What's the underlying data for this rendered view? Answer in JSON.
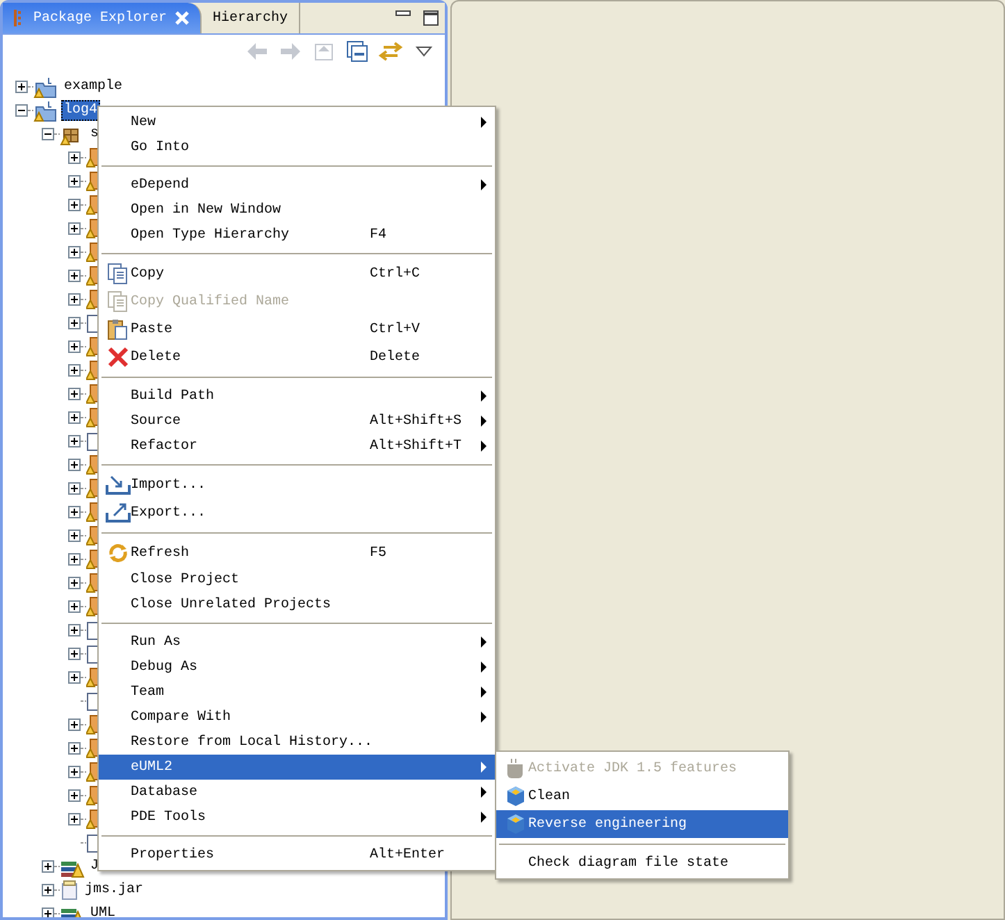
{
  "view_tabs": [
    {
      "label": "Package Explorer",
      "selected": true
    },
    {
      "label": "Hierarchy",
      "selected": false
    }
  ],
  "toolbar": [
    {
      "kind": "back",
      "disabled": true
    },
    {
      "kind": "forward",
      "disabled": true
    },
    {
      "kind": "up",
      "disabled": true
    },
    {
      "kind": "collapse",
      "disabled": false
    },
    {
      "kind": "link",
      "disabled": false
    },
    {
      "kind": "view-menu",
      "disabled": false
    }
  ],
  "tree": [
    {
      "label": "example",
      "kind": "project",
      "expanded": false,
      "selected": false
    },
    {
      "label": "log4",
      "kind": "project",
      "expanded": true,
      "selected": true,
      "children": [
        {
          "label": "s",
          "kind": "source",
          "expanded": true,
          "selected": false,
          "children": [
            {
              "kind": "package",
              "expanded": false
            },
            {
              "kind": "package",
              "expanded": false
            },
            {
              "kind": "package",
              "expanded": false
            },
            {
              "kind": "package",
              "expanded": false
            },
            {
              "kind": "package",
              "expanded": false
            },
            {
              "kind": "package",
              "expanded": false
            },
            {
              "kind": "package",
              "expanded": false
            },
            {
              "kind": "file",
              "expanded": false
            },
            {
              "kind": "package",
              "expanded": false
            },
            {
              "kind": "package",
              "expanded": false
            },
            {
              "kind": "package",
              "expanded": false
            },
            {
              "kind": "package",
              "expanded": false
            },
            {
              "kind": "file",
              "expanded": false
            },
            {
              "kind": "package",
              "expanded": false
            },
            {
              "kind": "package",
              "expanded": false
            },
            {
              "kind": "package",
              "expanded": false
            },
            {
              "kind": "package",
              "expanded": false
            },
            {
              "kind": "package",
              "expanded": false
            },
            {
              "kind": "package",
              "expanded": false
            },
            {
              "kind": "package",
              "expanded": false
            },
            {
              "kind": "file",
              "expanded": false
            },
            {
              "kind": "file",
              "expanded": false
            },
            {
              "kind": "package",
              "expanded": false
            },
            {
              "kind": "file"
            },
            {
              "kind": "package",
              "expanded": false
            },
            {
              "kind": "package",
              "expanded": false
            },
            {
              "kind": "package",
              "expanded": false
            },
            {
              "kind": "package",
              "expanded": false
            },
            {
              "kind": "package",
              "expanded": false
            },
            {
              "kind": "file"
            }
          ]
        },
        {
          "label": "J",
          "kind": "library",
          "expanded": false,
          "selected": false
        },
        {
          "label": "jms.jar",
          "kind": "jar",
          "expanded": false,
          "selected": false
        },
        {
          "label": "UML",
          "kind": "library",
          "expanded": false,
          "selected": false
        }
      ]
    }
  ],
  "context_menu": [
    {
      "kind": "item",
      "label": "New",
      "submenu": true,
      "selected": false
    },
    {
      "kind": "item",
      "label": "Go Into",
      "selected": false
    },
    {
      "kind": "separator"
    },
    {
      "kind": "item",
      "label": "eDepend",
      "submenu": true,
      "selected": false
    },
    {
      "kind": "item",
      "label": "Open in New Window",
      "selected": false
    },
    {
      "kind": "item",
      "label": "Open Type Hierarchy",
      "shortcut": "F4",
      "selected": false
    },
    {
      "kind": "separator"
    },
    {
      "kind": "item",
      "label": "Copy",
      "shortcut": "Ctrl+C",
      "selected": false
    },
    {
      "kind": "item",
      "label": "Copy Qualified Name",
      "disabled": true,
      "selected": false
    },
    {
      "kind": "item",
      "label": "Paste",
      "shortcut": "Ctrl+V",
      "selected": false
    },
    {
      "kind": "item",
      "label": "Delete",
      "shortcut": "Delete",
      "selected": false
    },
    {
      "kind": "separator"
    },
    {
      "kind": "item",
      "label": "Build Path",
      "submenu": true,
      "selected": false
    },
    {
      "kind": "item",
      "label": "Source",
      "shortcut": "Alt+Shift+S",
      "submenu": true,
      "selected": false
    },
    {
      "kind": "item",
      "label": "Refactor",
      "shortcut": "Alt+Shift+T",
      "submenu": true,
      "selected": false
    },
    {
      "kind": "separator"
    },
    {
      "kind": "item",
      "label": "Import...",
      "selected": false
    },
    {
      "kind": "item",
      "label": "Export...",
      "selected": false
    },
    {
      "kind": "separator"
    },
    {
      "kind": "item",
      "label": "Refresh",
      "shortcut": "F5",
      "selected": false
    },
    {
      "kind": "item",
      "label": "Close Project",
      "selected": false
    },
    {
      "kind": "item",
      "label": "Close Unrelated Projects",
      "selected": false
    },
    {
      "kind": "separator"
    },
    {
      "kind": "item",
      "label": "Run As",
      "submenu": true,
      "selected": false
    },
    {
      "kind": "item",
      "label": "Debug As",
      "submenu": true,
      "selected": false
    },
    {
      "kind": "item",
      "label": "Team",
      "submenu": true,
      "selected": false
    },
    {
      "kind": "item",
      "label": "Compare With",
      "submenu": true,
      "selected": false
    },
    {
      "kind": "item",
      "label": "Restore from Local History...",
      "selected": false
    },
    {
      "kind": "item",
      "label": "eUML2",
      "submenu": true,
      "selected": true
    },
    {
      "kind": "item",
      "label": "Database",
      "submenu": true,
      "selected": false
    },
    {
      "kind": "item",
      "label": "PDE Tools",
      "submenu": true,
      "selected": false
    },
    {
      "kind": "separator"
    },
    {
      "kind": "item",
      "label": "Properties",
      "shortcut": "Alt+Enter",
      "selected": false
    }
  ],
  "submenu": [
    {
      "kind": "item",
      "label": "Activate JDK 1.5 features",
      "disabled": true,
      "selected": false
    },
    {
      "kind": "item",
      "label": "Clean",
      "selected": false
    },
    {
      "kind": "item",
      "label": "Reverse engineering",
      "selected": true
    },
    {
      "kind": "separator"
    },
    {
      "kind": "item",
      "label": "Check diagram file state",
      "selected": false
    }
  ]
}
